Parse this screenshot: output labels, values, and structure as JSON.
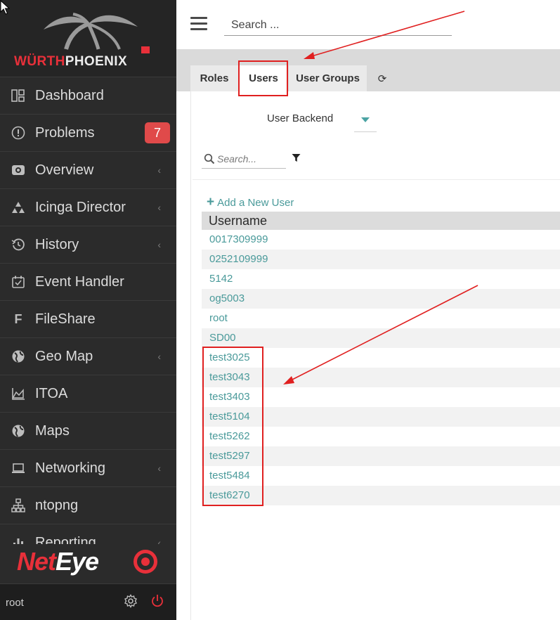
{
  "brand": {
    "part1": "WÜRTH",
    "part2": "PHOENIX"
  },
  "sidebar": {
    "items": [
      {
        "label": "Dashboard",
        "icon": "dashboard-icon",
        "chevron": ""
      },
      {
        "label": "Problems",
        "icon": "alert-circle-icon",
        "chevron": "",
        "badge": "7"
      },
      {
        "label": "Overview",
        "icon": "overview-icon",
        "chevron": "‹"
      },
      {
        "label": "Icinga Director",
        "icon": "director-icon",
        "chevron": "‹"
      },
      {
        "label": "History",
        "icon": "history-icon",
        "chevron": "‹"
      },
      {
        "label": "Event Handler",
        "icon": "event-handler-icon",
        "chevron": ""
      },
      {
        "label": "FileShare",
        "icon": "fileshare-icon",
        "chevron": ""
      },
      {
        "label": "Geo Map",
        "icon": "globe-icon",
        "chevron": "‹"
      },
      {
        "label": "ITOA",
        "icon": "area-chart-icon",
        "chevron": ""
      },
      {
        "label": "Maps",
        "icon": "globe-icon",
        "chevron": ""
      },
      {
        "label": "Networking",
        "icon": "laptop-icon",
        "chevron": "‹"
      },
      {
        "label": "ntopng",
        "icon": "network-icon",
        "chevron": ""
      },
      {
        "label": "Reporting",
        "icon": "bar-chart-icon",
        "chevron": "‹"
      }
    ],
    "fileshare_glyph": "F",
    "logo": {
      "part1": "Net",
      "part2": "Eye"
    },
    "user": "root"
  },
  "topbar": {
    "search_placeholder": "Search ..."
  },
  "tabs": {
    "roles": "Roles",
    "users": "Users",
    "groups": "User Groups",
    "refresh": "⟳"
  },
  "panel": {
    "backend_label": "User Backend",
    "filter_placeholder": "Search...",
    "add_user": "Add a New User",
    "add_user_plus": "+",
    "column_header": "Username",
    "rows": [
      "0017309999",
      "0252109999",
      "5142",
      "og5003",
      "root",
      "SD00",
      "test3025",
      "test3043",
      "test3403",
      "test5104",
      "test5262",
      "test5297",
      "test5484",
      "test6270"
    ]
  },
  "colors": {
    "accent": "#4a9a9a",
    "brand_red": "#e8303a",
    "sidebar_bg": "#2b2b2b",
    "badge": "#e04a4a",
    "annotation": "#e02020"
  }
}
